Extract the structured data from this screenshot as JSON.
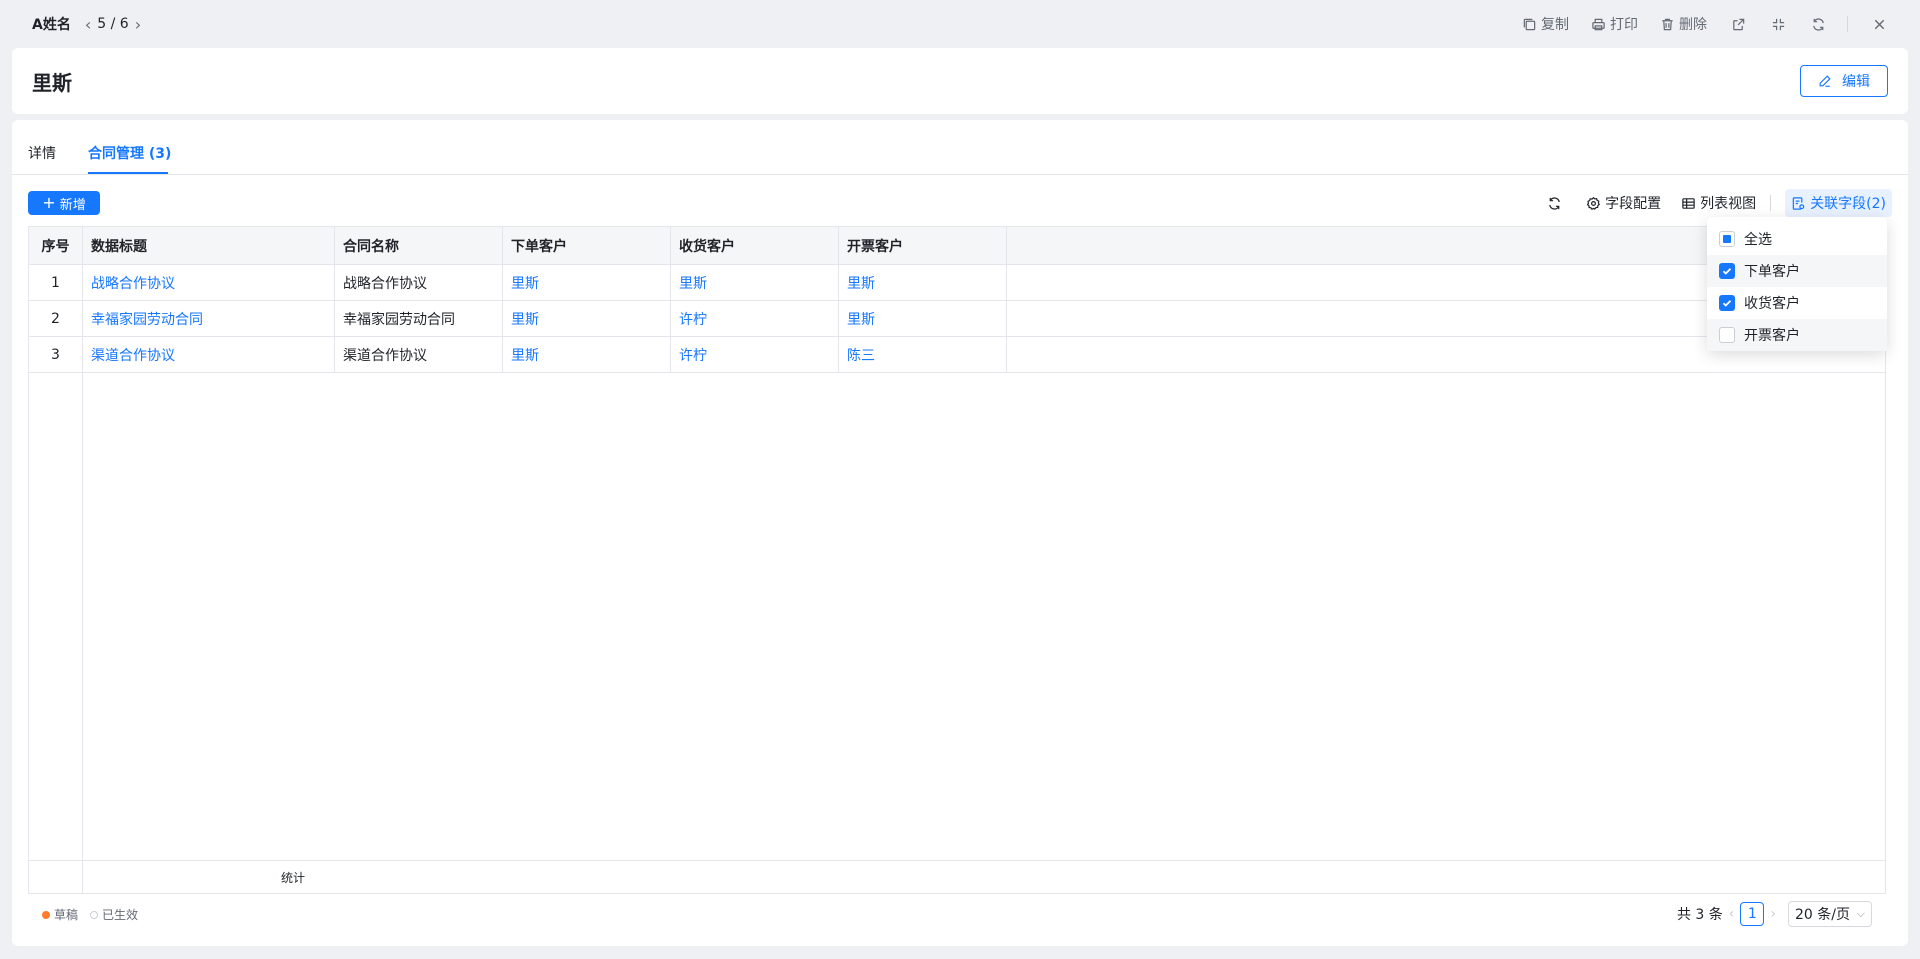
{
  "topbar": {
    "title": "A姓名",
    "pager_text": "5 / 6",
    "actions": {
      "copy": "复制",
      "print": "打印",
      "delete": "删除"
    }
  },
  "header": {
    "name": "里斯",
    "edit_label": "编辑"
  },
  "tabs": [
    {
      "label": "详情"
    },
    {
      "label": "合同管理 (3)"
    }
  ],
  "toolbar": {
    "add_label": "新增",
    "field_config": "字段配置",
    "list_view": "列表视图",
    "related_fields": "关联字段(2)"
  },
  "table": {
    "columns": [
      "序号",
      "数据标题",
      "合同名称",
      "下单客户",
      "收货客户",
      "开票客户"
    ],
    "rows": [
      {
        "index": "1",
        "title": "战略合作协议",
        "contract": "战略合作协议",
        "order_customer": "里斯",
        "receive_customer": "里斯",
        "invoice_customer": "里斯"
      },
      {
        "index": "2",
        "title": "幸福家园劳动合同",
        "contract": "幸福家园劳动合同",
        "order_customer": "里斯",
        "receive_customer": "许柠",
        "invoice_customer": "里斯"
      },
      {
        "index": "3",
        "title": "渠道合作协议",
        "contract": "渠道合作协议",
        "order_customer": "里斯",
        "receive_customer": "许柠",
        "invoice_customer": "陈三"
      }
    ],
    "footer_label": "统计"
  },
  "legend": {
    "draft": "草稿",
    "active": "已生效"
  },
  "pagination": {
    "total": "共 3 条",
    "current": "1",
    "page_size": "20 条/页"
  },
  "popover": {
    "items": [
      {
        "label": "全选",
        "state": "indeterminate"
      },
      {
        "label": "下单客户",
        "state": "checked"
      },
      {
        "label": "收货客户",
        "state": "checked"
      },
      {
        "label": "开票客户",
        "state": "unchecked"
      }
    ]
  },
  "colors": {
    "primary": "#1677ff",
    "draft": "#ff7d2b"
  }
}
